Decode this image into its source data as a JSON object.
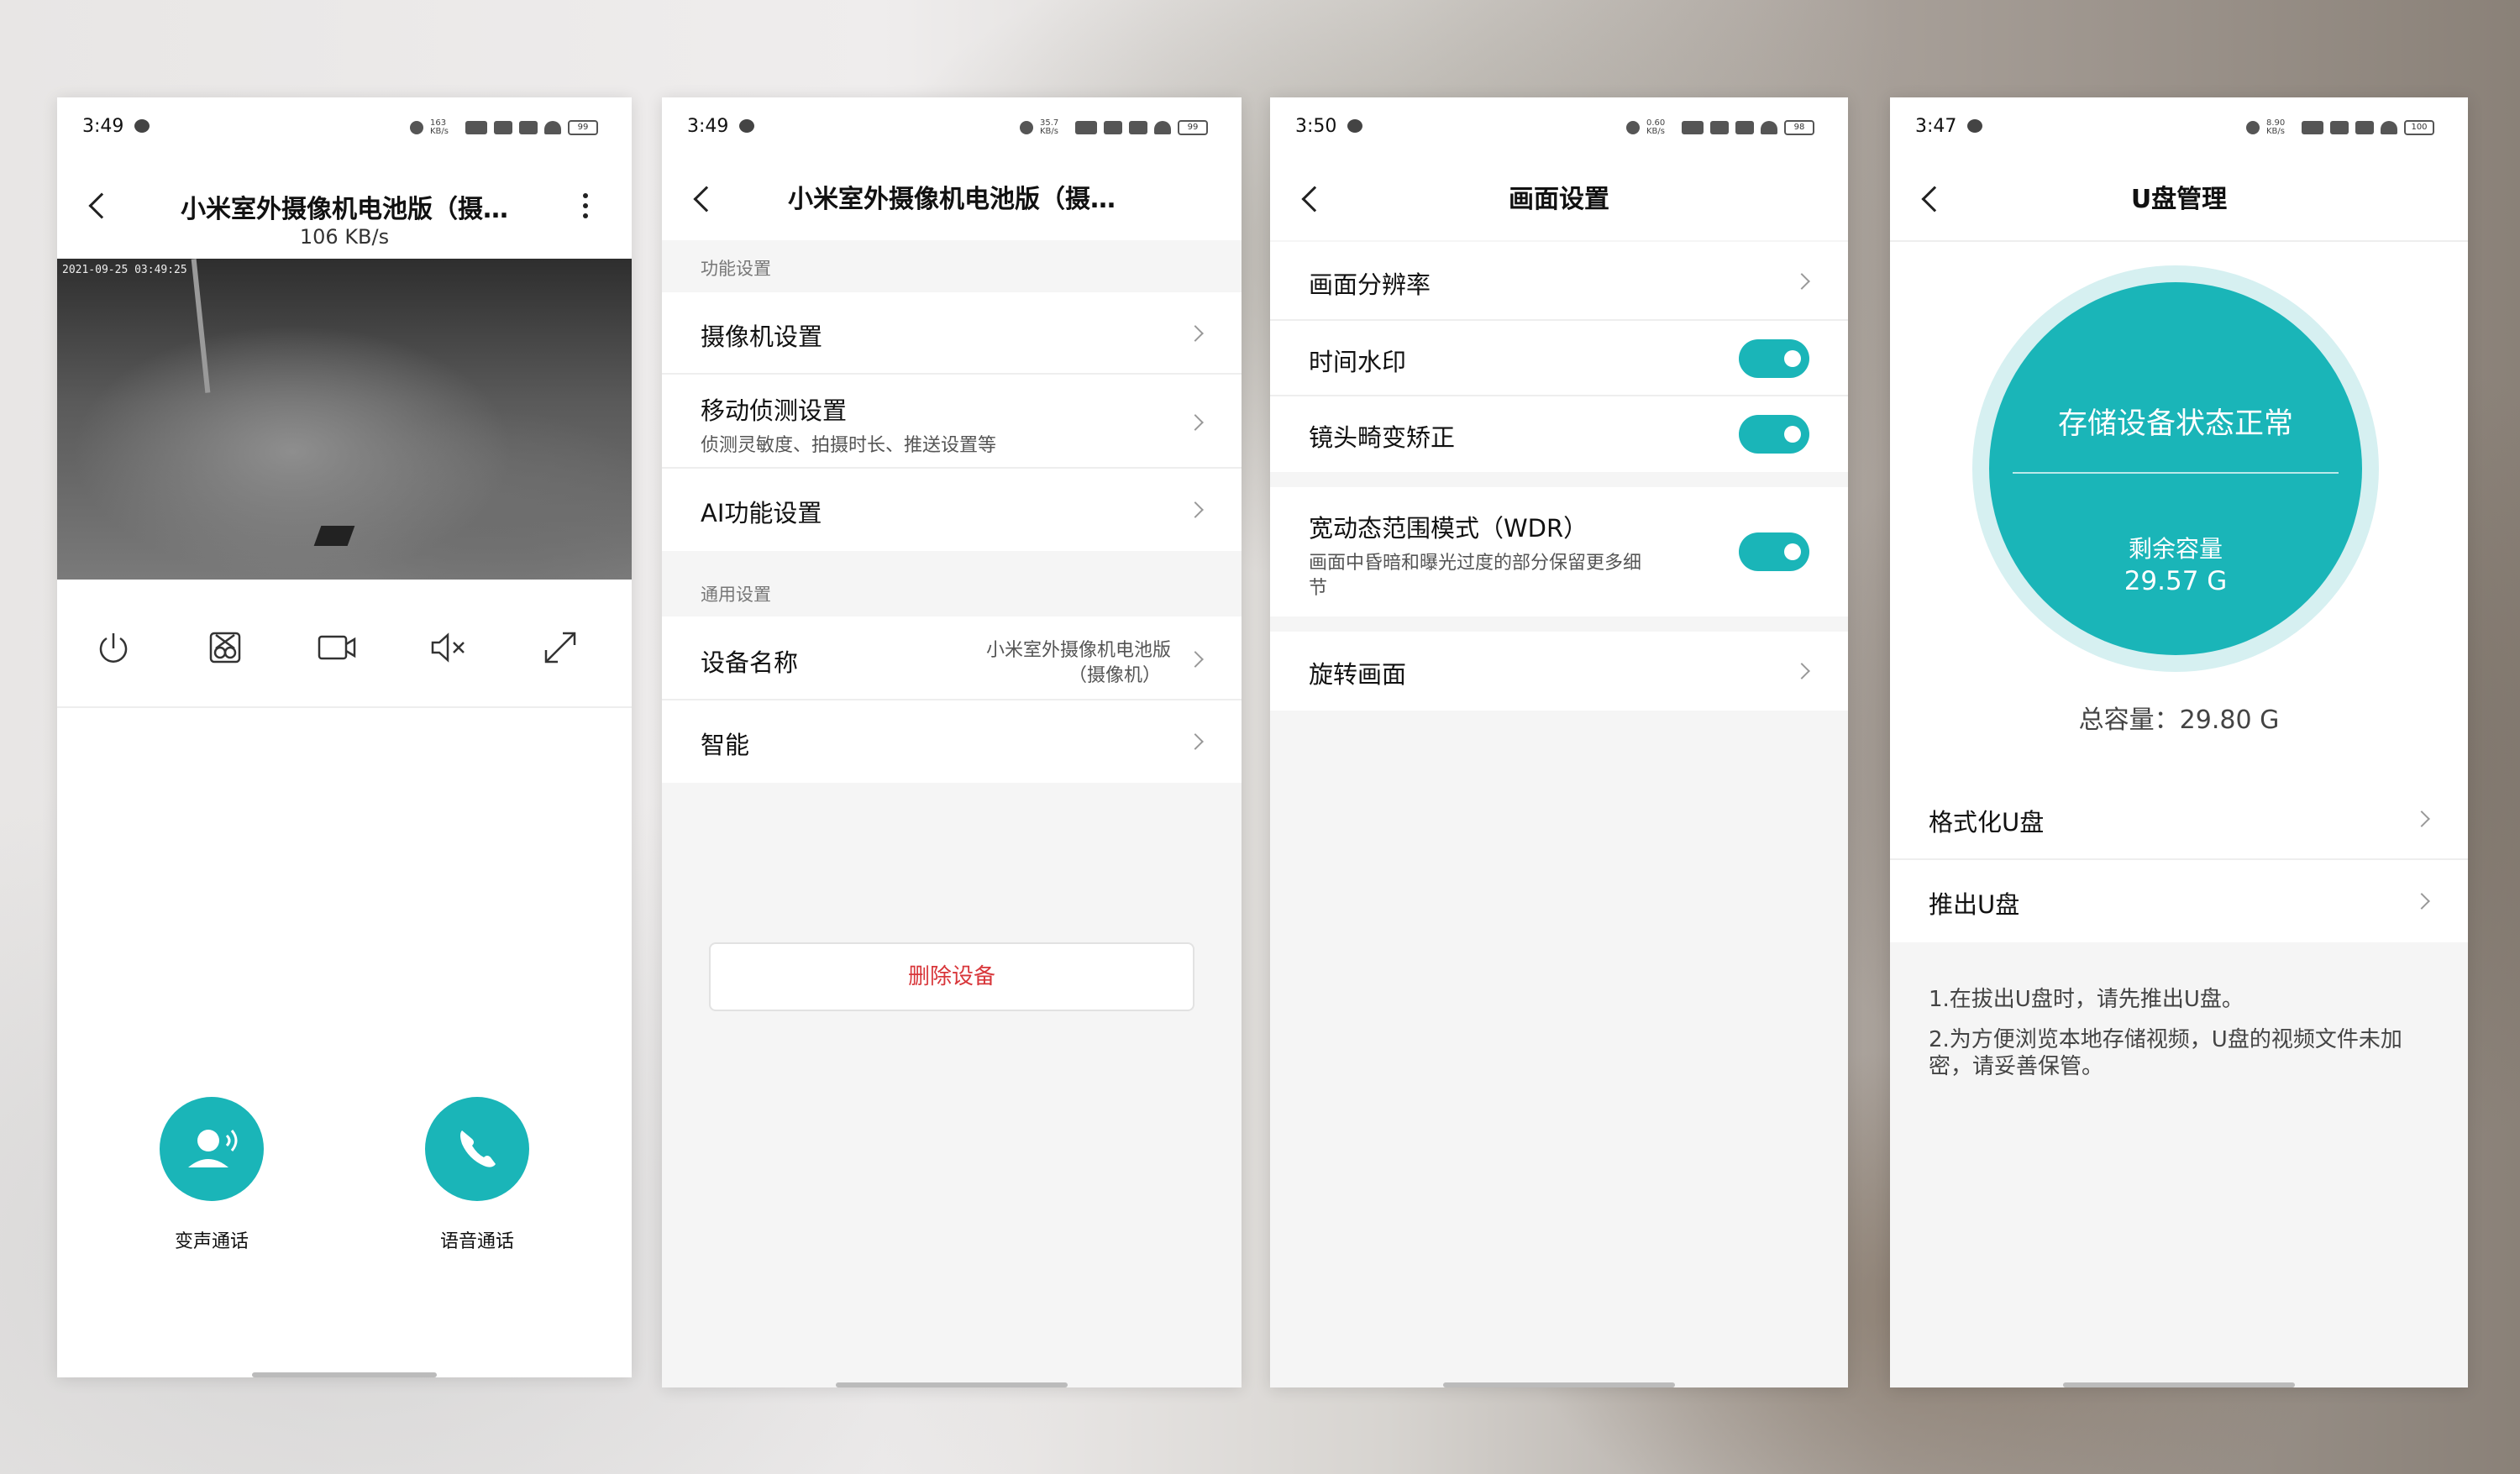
{
  "colors": {
    "accent": "#1ab5b8",
    "danger": "#d8363a"
  },
  "screen1": {
    "time": "3:49",
    "net": "163 KB/s",
    "battery": "99",
    "title": "小米室外摄像机电池版（摄…",
    "speed": "106 KB/s",
    "timestamp": "2021-09-25 03:49:25",
    "controls": [
      "power-icon",
      "pinwheel-icon",
      "video-camera-icon",
      "mute-icon",
      "fullscreen-icon"
    ],
    "voice_change_label": "变声通话",
    "voice_call_label": "语音通话"
  },
  "screen2": {
    "time": "3:49",
    "net": "35.7 KB/s",
    "battery": "99",
    "title": "小米室外摄像机电池版（摄…",
    "section1": "功能设置",
    "camera_settings": "摄像机设置",
    "motion_detection": "移动侦测设置",
    "motion_detection_sub": "侦测灵敏度、拍摄时长、推送设置等",
    "ai_settings": "AI功能设置",
    "section2": "通用设置",
    "device_name_label": "设备名称",
    "device_name_value_1": "小米室外摄像机电池版",
    "device_name_value_2": "（摄像机）",
    "smart_label": "智能",
    "delete_button": "删除设备"
  },
  "screen3": {
    "time": "3:50",
    "net": "0.60 KB/s",
    "battery": "98",
    "title": "画面设置",
    "resolution": "画面分辨率",
    "time_watermark": "时间水印",
    "lens_correction": "镜头畸变矫正",
    "wdr_label": "宽动态范围模式（WDR）",
    "wdr_sub_1": "画面中昏暗和曝光过度的部分保留更多细",
    "wdr_sub_2": "节",
    "rotate": "旋转画面",
    "toggles": {
      "time_watermark": true,
      "lens_correction": true,
      "wdr": true
    }
  },
  "screen4": {
    "time": "3:47",
    "net": "8.90 KB/s",
    "battery": "100",
    "title": "U盘管理",
    "status": "存储设备状态正常",
    "remaining_label": "剩余容量",
    "remaining_value": "29.57 G",
    "total": "总容量：29.80 G",
    "format": "格式化U盘",
    "eject": "推出U盘",
    "note1": "1.在拔出U盘时，请先推出U盘。",
    "note2": "2.为方便浏览本地存储视频，U盘的视频文件未加密，请妥善保管。"
  }
}
